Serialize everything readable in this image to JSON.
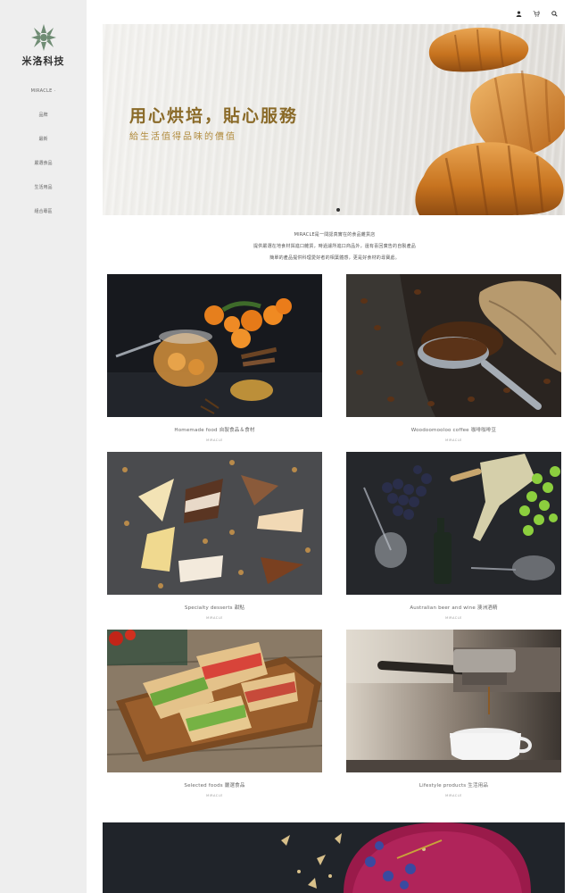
{
  "brand": {
    "name": "米洛科技"
  },
  "nav": {
    "items": [
      "MIRACLE ·",
      "品牌",
      "最新",
      "嚴選食品",
      "生活用品",
      "組合專區"
    ]
  },
  "topbar": {
    "icons": [
      "user-icon",
      "cart-icon",
      "search-icon"
    ]
  },
  "hero": {
    "title": "用心烘培，貼心服務",
    "subtitle": "給生活值得品味的價值"
  },
  "intro": {
    "lines": [
      "MIRACLE是一間認真實在的食品雜貨店",
      "提供嚴選在地食材與進口雜貨，時過濾所進口商品外，還有喜回廣告的自製產品",
      "簡單的產品提供科理愛好者的相葉體感，更是好食材的尋寶處。"
    ]
  },
  "products": [
    {
      "caption": "Homemade food 自製食品＆食材",
      "sub": "MIRACLE"
    },
    {
      "caption": "Woodoomooloo coffee 咖啡咖啡豆",
      "sub": "MIRACLE"
    },
    {
      "caption": "Specialty desserts 甜點",
      "sub": "MIRACLE"
    },
    {
      "caption": "Australian beer and wine 澳洲酒精",
      "sub": "MIRACLE"
    },
    {
      "caption": "Selected foods 嚴選食品",
      "sub": "MIRACLE"
    },
    {
      "caption": "Lifestyle products 生活用品",
      "sub": "MIRACLE"
    }
  ],
  "colors": {
    "sidebar": "#eeeeee",
    "heroTitle": "#8a6a28",
    "heroSub": "#b08a3c"
  }
}
